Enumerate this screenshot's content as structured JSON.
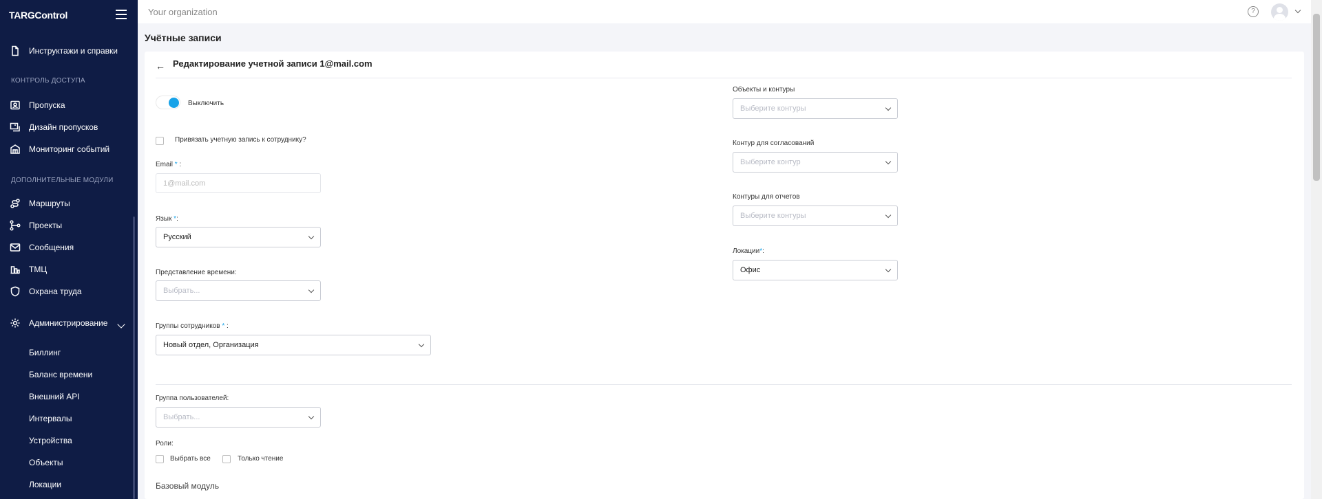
{
  "app": {
    "logo": "TARGControl"
  },
  "sidebar": {
    "top_item": {
      "label": "Инструктажи и справки",
      "icon": "document-icon"
    },
    "section_access": "КОНТРОЛЬ ДОСТУПА",
    "access_items": [
      {
        "label": "Пропуска",
        "icon": "badge-icon"
      },
      {
        "label": "Дизайн пропусков",
        "icon": "design-icon"
      },
      {
        "label": "Мониторинг событий",
        "icon": "monitor-icon"
      }
    ],
    "section_modules": "ДОПОЛНИТЕЛЬНЫЕ МОДУЛИ",
    "module_items": [
      {
        "label": "Маршруты",
        "icon": "route-icon"
      },
      {
        "label": "Проекты",
        "icon": "project-icon"
      },
      {
        "label": "Сообщения",
        "icon": "mail-icon"
      },
      {
        "label": "ТМЦ",
        "icon": "inventory-icon"
      },
      {
        "label": "Охрана труда",
        "icon": "shield-icon"
      }
    ],
    "admin": {
      "label": "Администрирование",
      "icon": "gear-icon"
    },
    "admin_items": [
      "Биллинг",
      "Баланс времени",
      "Внешний API",
      "Интервалы",
      "Устройства",
      "Объекты",
      "Локации"
    ]
  },
  "topbar": {
    "organization": "Your organization",
    "help": "?"
  },
  "page": {
    "title": "Учётные записи"
  },
  "form": {
    "back": "←",
    "title": "Редактирование учетной записи 1@mail.com",
    "toggle_label": "Выключить",
    "link_employee": "Привязать учетную запись к сотруднику?",
    "email_label": "Email",
    "email_req": "*",
    "email_suffix": " :",
    "email_placeholder": "1@mail.com",
    "lang_label": "Язык",
    "lang_req": "*",
    "lang_suffix": ":",
    "lang_value": "Русский",
    "time_label": "Представление времени:",
    "time_placeholder": "Выбрать...",
    "groups_label": "Группы сотрудников",
    "groups_req": "*",
    "groups_suffix": " :",
    "groups_value": "Новый отдел, Организация",
    "user_group_label": "Группа пользователей:",
    "user_group_placeholder": "Выбрать...",
    "roles_label": "Роли:",
    "select_all": "Выбрать все",
    "read_only": "Только чтение",
    "base_module": "Базовый модуль",
    "objects_label": "Объекты и контуры",
    "objects_placeholder": "Выберите контуры",
    "approval_label": "Контур для согласований",
    "approval_placeholder": "Выберите контур",
    "reports_label": "Контуры для отчетов",
    "reports_placeholder": "Выберите контуры",
    "locations_label": "Локации",
    "locations_req": "*",
    "locations_suffix": ":",
    "locations_value": "Офис"
  }
}
